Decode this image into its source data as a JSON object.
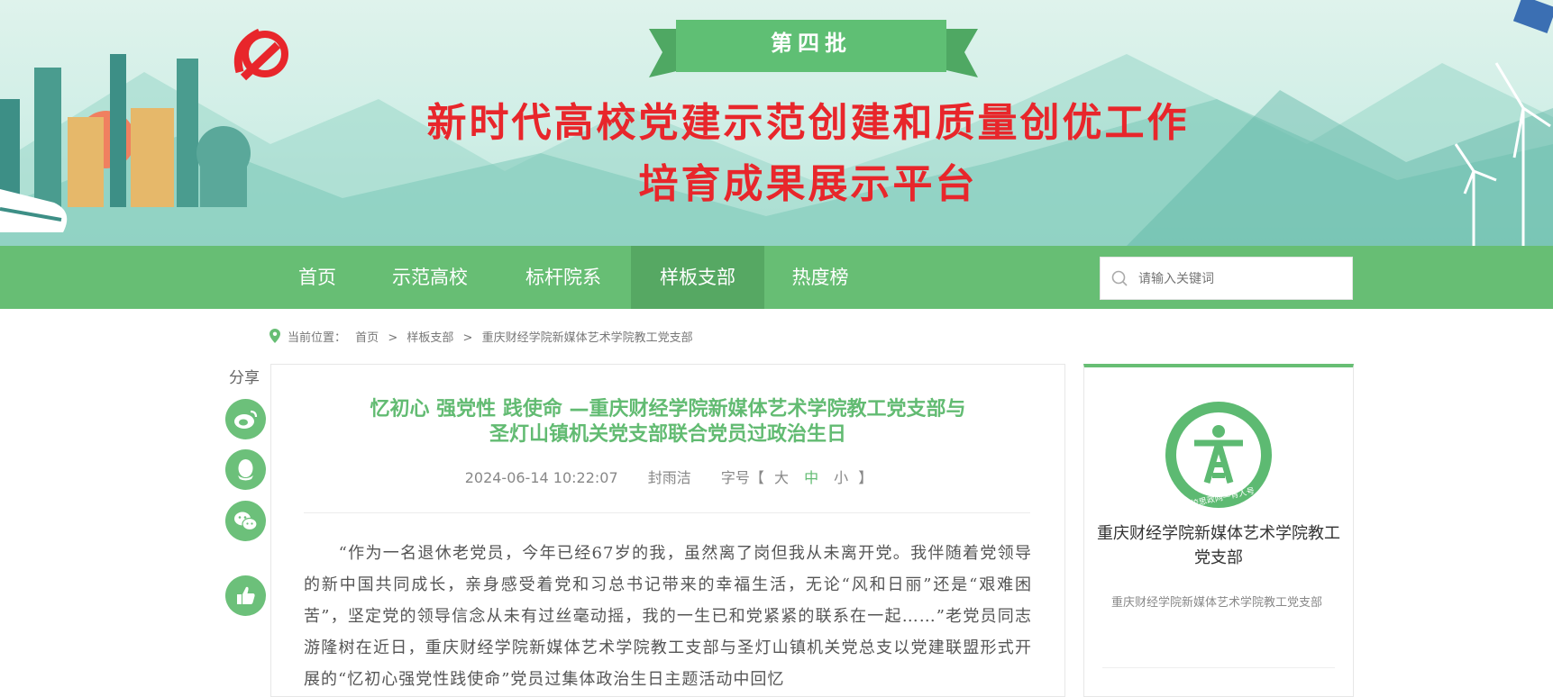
{
  "banner": {
    "batch": "第四批",
    "title_line1": "新时代高校党建示范创建和质量创优工作",
    "title_line2": "培育成果展示平台"
  },
  "nav": {
    "items": [
      {
        "label": "首页"
      },
      {
        "label": "示范高校"
      },
      {
        "label": "标杆院系"
      },
      {
        "label": "样板支部"
      },
      {
        "label": "热度榜"
      }
    ],
    "active_index": 3,
    "search_placeholder": "请输入关键词"
  },
  "breadcrumb": {
    "prefix": "当前位置：",
    "items": [
      "首页",
      "样板支部",
      "重庆财经学院新媒体艺术学院教工党支部"
    ],
    "separator": ">"
  },
  "share": {
    "label": "分享",
    "buttons": [
      "weibo-icon",
      "qq-icon",
      "wechat-icon",
      "thumbs-up-icon"
    ]
  },
  "article": {
    "title_line1": "忆初心 强党性 践使命 —重庆财经学院新媒体艺术学院教工党支部与",
    "title_line2": "圣灯山镇机关党支部联合党员过政治生日",
    "date": "2024-06-14 10:22:07",
    "author": "封雨洁",
    "font_size_label": "字号【",
    "font_size_end": "】",
    "font_sizes": [
      "大",
      "中",
      "小"
    ],
    "font_size_selected": "中",
    "body": "　　“作为一名退休老党员，今年已经67岁的我，虽然离了岗但我从未离开党。我伴随着党领导的新中国共同成长，亲身感受着党和习总书记带来的幸福生活，无论“风和日丽”还是“艰难困苦”，坚定党的领导信念从未有过丝毫动摇，我的一生已和党紧紧的联系在一起……”老党员同志游隆树在近日，重庆财经学院新媒体艺术学院教工支部与圣灯山镇机关党总支以党建联盟形式开展的“忆初心强党性践使命”党员过集体政治生日主题活动中回忆"
  },
  "side": {
    "logo_text": "高校思政网—育人号",
    "name": "重庆财经学院新媒体艺术学院教工党支部",
    "desc": "重庆财经学院新媒体艺术学院教工党支部"
  },
  "colors": {
    "brand_green": "#67be74",
    "title_red": "#e8262b",
    "article_title": "#62bb72"
  }
}
